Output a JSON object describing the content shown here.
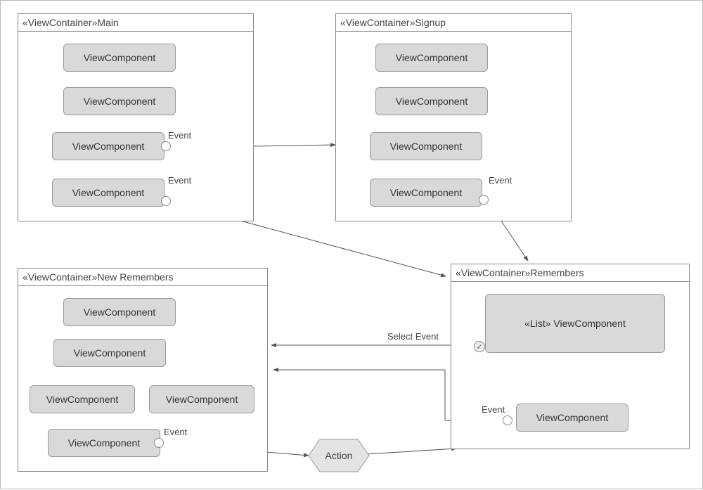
{
  "containers": {
    "main": {
      "title": "«ViewContainer»Main"
    },
    "signup": {
      "title": "«ViewContainer»Signup"
    },
    "newremembers": {
      "title": "«ViewContainer»New Remembers"
    },
    "remembers": {
      "title": "«ViewContainer»Remembers"
    }
  },
  "labels": {
    "viewcomponent": "ViewComponent",
    "list_viewcomponent": "«List» ViewComponent",
    "event": "Event",
    "select_event": "Select Event",
    "action": "Action"
  }
}
